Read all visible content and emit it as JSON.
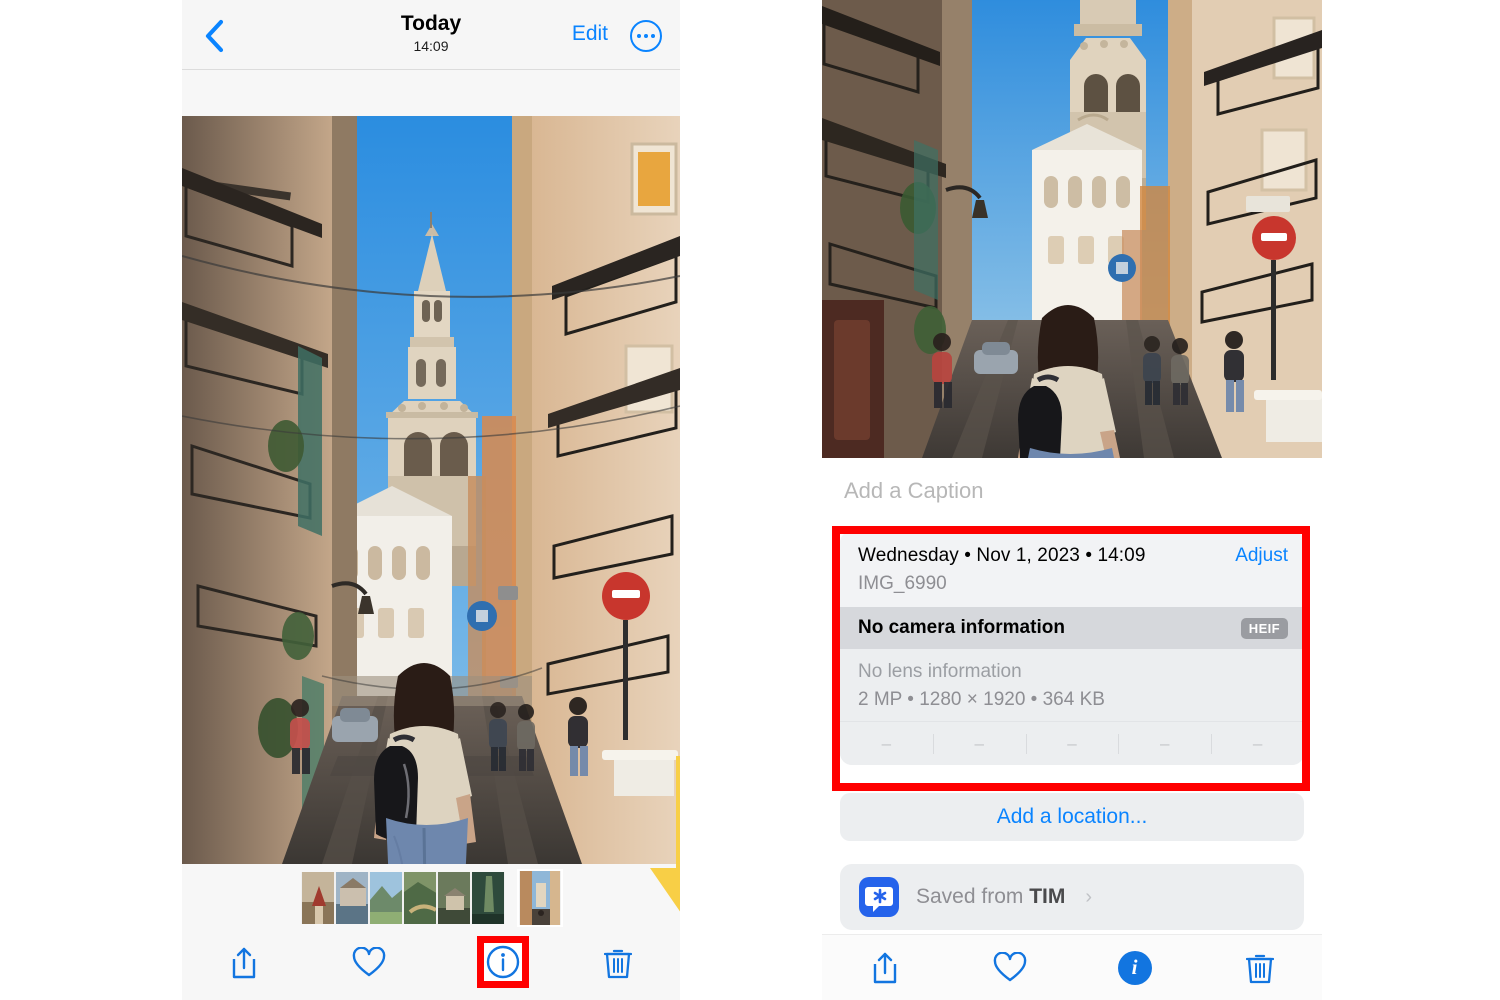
{
  "left_panel": {
    "navbar": {
      "back_icon": "chevron-left-icon",
      "title": "Today",
      "subtitle": "14:09",
      "edit_label": "Edit",
      "more_icon": "ellipsis-circle-icon"
    },
    "photo": {
      "alt": "Narrow Valencia street with bell tower and woman walking away with backpack"
    },
    "thumbnails": [
      {
        "name": "thumb-1"
      },
      {
        "name": "thumb-2"
      },
      {
        "name": "thumb-3"
      },
      {
        "name": "thumb-4"
      },
      {
        "name": "thumb-5"
      },
      {
        "name": "thumb-6"
      },
      {
        "name": "thumb-selected"
      }
    ],
    "toolbar": {
      "share_icon": "share-icon",
      "favorite_icon": "heart-icon",
      "info_icon": "info-circle-icon",
      "delete_icon": "trash-icon"
    },
    "annotations": {
      "arrow_color": "#f8cf46",
      "highlight_color": "#ff0000"
    }
  },
  "right_panel": {
    "photo": {
      "alt": "Same Valencia street photo cropped to top portion"
    },
    "caption": {
      "placeholder": "Add a Caption",
      "value": ""
    },
    "info_card": {
      "datetime": "Wednesday • Nov 1, 2023 • 14:09",
      "filename": "IMG_6990",
      "adjust_label": "Adjust",
      "camera_info": "No camera information",
      "format_badge": "HEIF",
      "lens_info": "No lens information",
      "size_line": "2 MP • 1280 × 1920 • 364 KB",
      "exif_values": [
        "–",
        "–",
        "–",
        "–",
        "–"
      ]
    },
    "location": {
      "add_label": "Add a location..."
    },
    "saved_from": {
      "prefix": "Saved from",
      "app": "TIM",
      "app_icon": "tim-app-icon",
      "chevron": "›"
    },
    "toolbar": {
      "share_icon": "share-icon",
      "favorite_icon": "heart-icon",
      "info_icon": "info-circle-filled-icon",
      "info_letter": "i",
      "delete_icon": "trash-icon"
    }
  },
  "colors": {
    "ios_blue": "#0a84ff",
    "accent_blue": "#1275e0",
    "highlight_red": "#ff0000",
    "arrow_yellow": "#f8cf46",
    "card_gray": "#eceef0",
    "band_gray": "#d6d8dc"
  }
}
